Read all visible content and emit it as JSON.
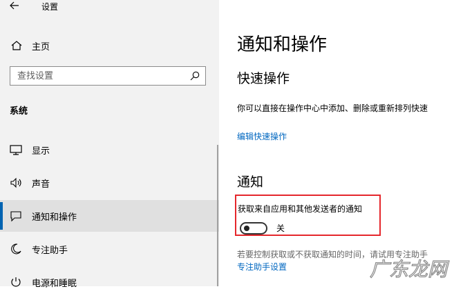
{
  "window": {
    "title": "设置"
  },
  "sidebar": {
    "home_label": "主页",
    "search_placeholder": "查找设置",
    "section_title": "系统",
    "items": [
      {
        "label": "显示",
        "icon": "monitor-icon"
      },
      {
        "label": "声音",
        "icon": "speaker-icon"
      },
      {
        "label": "通知和操作",
        "icon": "notification-icon",
        "selected": true
      },
      {
        "label": "专注助手",
        "icon": "moon-icon"
      },
      {
        "label": "电源和睡眠",
        "icon": "power-icon"
      }
    ]
  },
  "main": {
    "page_title": "通知和操作",
    "quick_actions_heading": "快速操作",
    "quick_actions_desc": "你可以直接在操作中心中添加、删除或重新排列快速",
    "edit_quick_actions_link": "编辑快速操作",
    "notifications_heading": "通知",
    "get_notifications_label": "获取来自应用和其他发送者的通知",
    "toggle_state": "关",
    "toggle_on": false,
    "focus_desc": "若要控制获取或不获取通知的时间，请试用专注助手",
    "focus_link": "专注助手设置"
  },
  "watermark": {
    "text": "广东龙网"
  },
  "colors": {
    "accent": "#0063b1",
    "link": "#0067c0",
    "highlight_border": "#e5262b"
  }
}
